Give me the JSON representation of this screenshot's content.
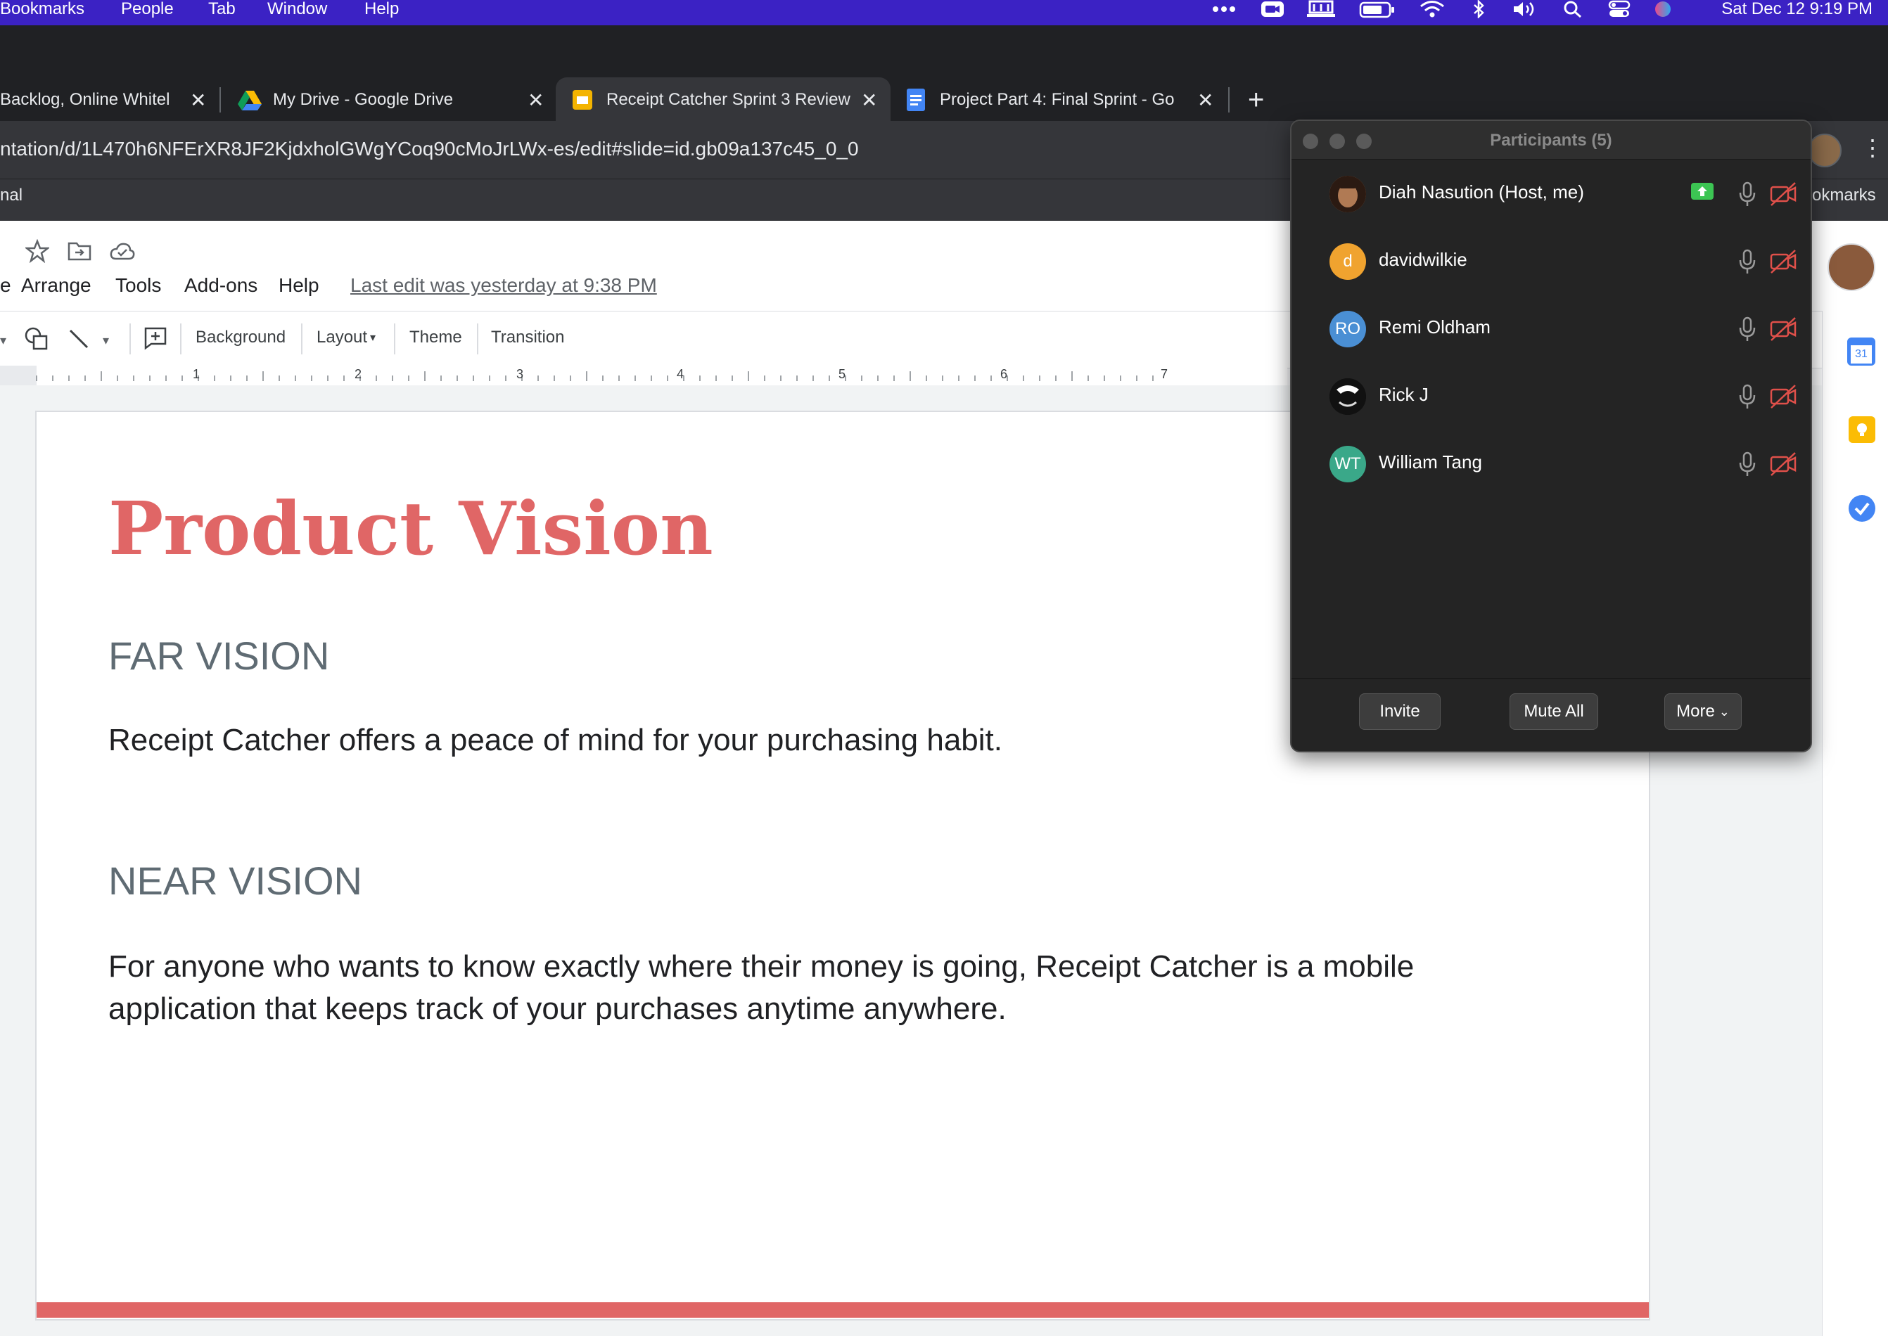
{
  "menubar": {
    "items": [
      "Bookmarks",
      "People",
      "Tab",
      "Window",
      "Help"
    ],
    "clock": "Sat Dec 12  9:19 PM"
  },
  "tabs": [
    {
      "title": "Backlog, Online Whitel"
    },
    {
      "title": "My Drive - Google Drive"
    },
    {
      "title": "Receipt Catcher Sprint 3 Review"
    },
    {
      "title": "Project Part 4: Final Sprint - Go"
    }
  ],
  "addressbar": {
    "url": "ntation/d/1L470h6NFErXR8JF2KjdxholGWgYCoq90cMoJrLWx-es/edit#slide=id.gb09a137c45_0_0"
  },
  "bookmarks": {
    "left": "nal",
    "right": "okmarks"
  },
  "slides_menu": {
    "items": [
      "e",
      "Arrange",
      "Tools",
      "Add-ons",
      "Help"
    ],
    "last_edit": "Last edit was yesterday at 9:38 PM"
  },
  "toolbar": {
    "background": "Background",
    "layout": "Layout",
    "theme": "Theme",
    "transition": "Transition"
  },
  "ruler": {
    "labels": [
      "1",
      "2",
      "3",
      "4",
      "5",
      "6",
      "7"
    ]
  },
  "slide": {
    "title": "Product Vision",
    "far_heading": "FAR VISION",
    "far_text": "Receipt Catcher offers a peace of mind for your purchasing habit.",
    "near_heading": "NEAR VISION",
    "near_text_1": "For anyone who wants to know exactly where their money is going, Receipt Catcher is a mobile",
    "near_text_2": "application that keeps track of your purchases anytime anywhere."
  },
  "zoom": {
    "title": "Participants (5)",
    "participants": [
      {
        "name": "Diah Nasution (Host, me)",
        "initials": "",
        "color": "#8a5a3c"
      },
      {
        "name": "davidwilkie",
        "initials": "d",
        "color": "#f0a32f"
      },
      {
        "name": "Remi Oldham",
        "initials": "RO",
        "color": "#4a8fd4"
      },
      {
        "name": "Rick J",
        "initials": "",
        "color": "#111111"
      },
      {
        "name": "William Tang",
        "initials": "WT",
        "color": "#3aa889"
      }
    ],
    "buttons": {
      "invite": "Invite",
      "mute_all": "Mute All",
      "more": "More"
    }
  },
  "sidepanel": {
    "calendar_day": "31"
  },
  "colors": {
    "menubar": "#3b22c4",
    "accent": "#e06666",
    "share_badge": "#3cc553"
  }
}
